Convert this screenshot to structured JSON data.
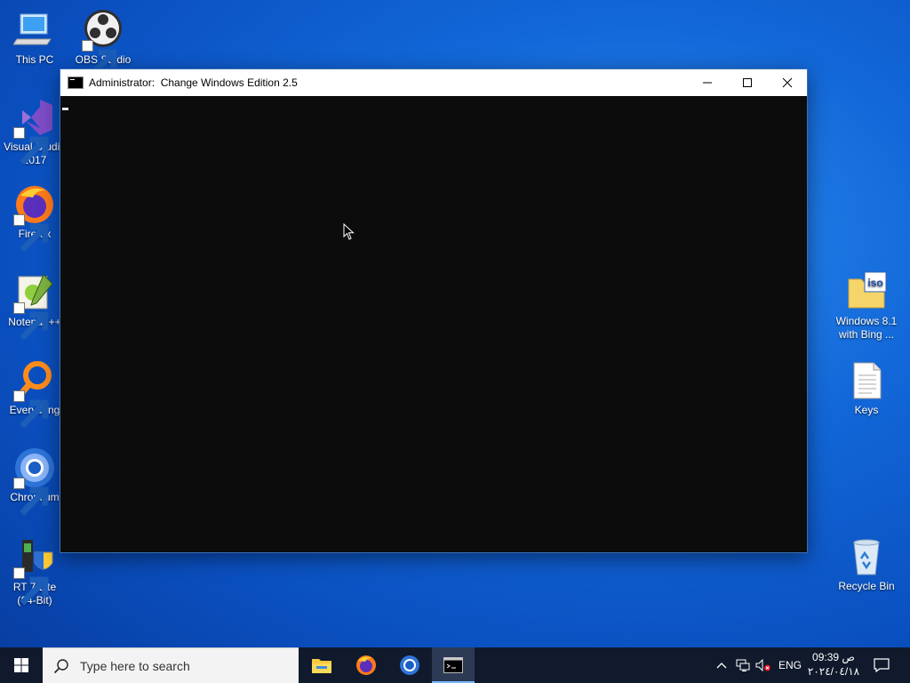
{
  "desktop": {
    "icons_left": [
      {
        "id": "this-pc",
        "label": "This PC"
      },
      {
        "id": "obs-studio",
        "label": "OBS Studio"
      },
      {
        "id": "visual-studio",
        "label": "Visual Studio 2017",
        "line1": "Visual Studio",
        "line2": "2017"
      },
      {
        "id": "firefox",
        "label": "Firefox"
      },
      {
        "id": "notepad-plus-plus",
        "label": "Notepad++"
      },
      {
        "id": "everything",
        "label": "Everything"
      },
      {
        "id": "chromium",
        "label": "Chromium"
      },
      {
        "id": "rt7lite",
        "label": "RT 7 Lite (64-Bit)",
        "line1": "RT 7 Lite",
        "line2": "(64-Bit)"
      }
    ],
    "icons_right": [
      {
        "id": "windows-iso",
        "label": "Windows 8.1 with Bing ...",
        "line1": "Windows 8.1",
        "line2": "with Bing ..."
      },
      {
        "id": "keys",
        "label": "Keys"
      },
      {
        "id": "recycle-bin",
        "label": "Recycle Bin"
      }
    ]
  },
  "window": {
    "title": "Administrator:  Change Windows Edition 2.5",
    "minimize_symbol": "─",
    "maximize_symbol": "☐",
    "close_symbol": "✕"
  },
  "taskbar": {
    "search_placeholder": "Type here to search",
    "apps": [
      "file-explorer",
      "firefox",
      "chromium",
      "command-prompt"
    ],
    "language": "ENG",
    "time": "09:39 ص",
    "date": "٢٠٢٤/٠٤/١٨"
  },
  "colors": {
    "desktop_blue": "#1267d8",
    "console_bg": "#0c0c0c",
    "taskbar_bg": "#101a2c"
  }
}
